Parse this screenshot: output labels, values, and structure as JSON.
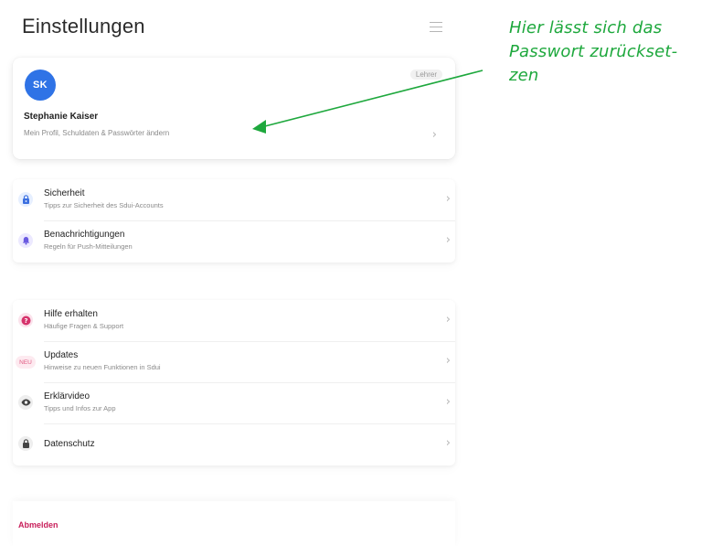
{
  "page": {
    "title": "Einstellungen"
  },
  "profile": {
    "initials": "SK",
    "role": "Lehrer",
    "name": "Stephanie Kaiser",
    "subtitle": "Mein Profil, Schuldaten & Passwörter ändern"
  },
  "group1": [
    {
      "title": "Sicherheit",
      "subtitle": "Tipps zur Sicherheit des Sdui-Accounts",
      "icon": "lock-icon",
      "color": "#3b6fe0"
    },
    {
      "title": "Benachrichtigungen",
      "subtitle": "Regeln für Push-Mitteilungen",
      "icon": "bell-icon",
      "color": "#6a5ae0"
    }
  ],
  "group2": [
    {
      "title": "Hilfe erhalten",
      "subtitle": "Häufige Fragen & Support",
      "icon": "question-icon",
      "color": "#d6336c"
    },
    {
      "title": "Updates",
      "subtitle": "Hinweise zu neuen Funktionen in Sdui",
      "icon": "new-badge-icon",
      "badge": "NEU",
      "color": "#e05a82"
    },
    {
      "title": "Erklärvideo",
      "subtitle": "Tipps und Infos zur App",
      "icon": "eye-icon",
      "color": "#444444"
    },
    {
      "title": "Datenschutz",
      "subtitle": "",
      "icon": "padlock-icon",
      "color": "#444444"
    }
  ],
  "logout": {
    "label": "Abmelden",
    "color": "#c81e5a"
  },
  "annotation": {
    "line1": "Hier lässt sich das",
    "line2": "Passwort zurückset-",
    "line3": "zen",
    "color": "#1ea83d"
  }
}
